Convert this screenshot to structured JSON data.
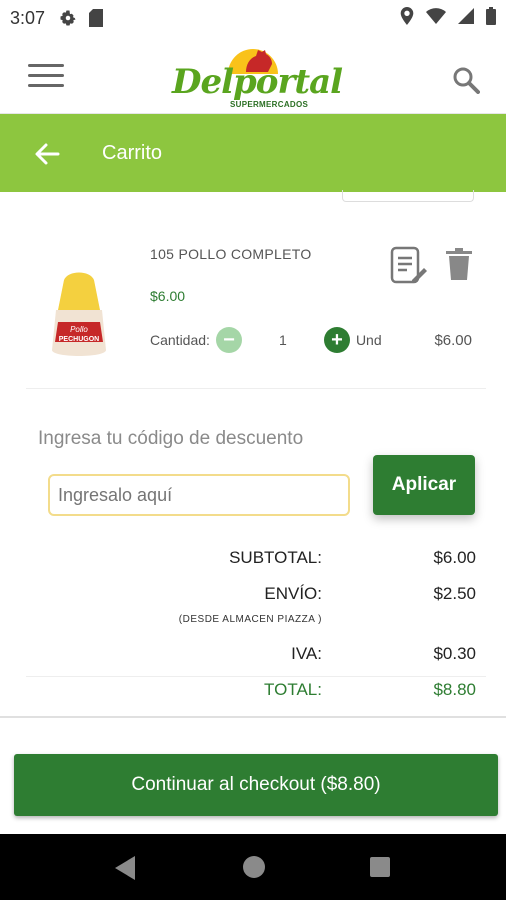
{
  "status_bar": {
    "time": "3:07"
  },
  "header": {
    "logo_text": "Delportal",
    "logo_sub": "SUPERMERCADOS"
  },
  "title_bar": {
    "title": "Carrito"
  },
  "cart": {
    "item": {
      "name": "105 POLLO COMPLETO",
      "price": "$6.00",
      "quantity_label": "Cantidad:",
      "quantity": "1",
      "unit": "Und",
      "line_total": "$6.00",
      "image_label": "Pollo PECHUGON"
    }
  },
  "discount": {
    "label": "Ingresa tu código de descuento",
    "placeholder": "Ingresalo aquí",
    "apply_label": "Aplicar"
  },
  "totals": {
    "subtotal_label": "SUBTOTAL:",
    "subtotal": "$6.00",
    "shipping_label": "ENVÍO:",
    "shipping": "$2.50",
    "shipping_note": "(DESDE ALMACEN PIAZZA )",
    "tax_label": "IVA:",
    "tax": "$0.30",
    "total_label": "TOTAL:",
    "total": "$8.80"
  },
  "checkout": {
    "label": "Continuar al checkout ($8.80)"
  },
  "colors": {
    "brand_green": "#8dc63f",
    "dark_green": "#2e7d32",
    "input_border": "#f3dc8b"
  }
}
